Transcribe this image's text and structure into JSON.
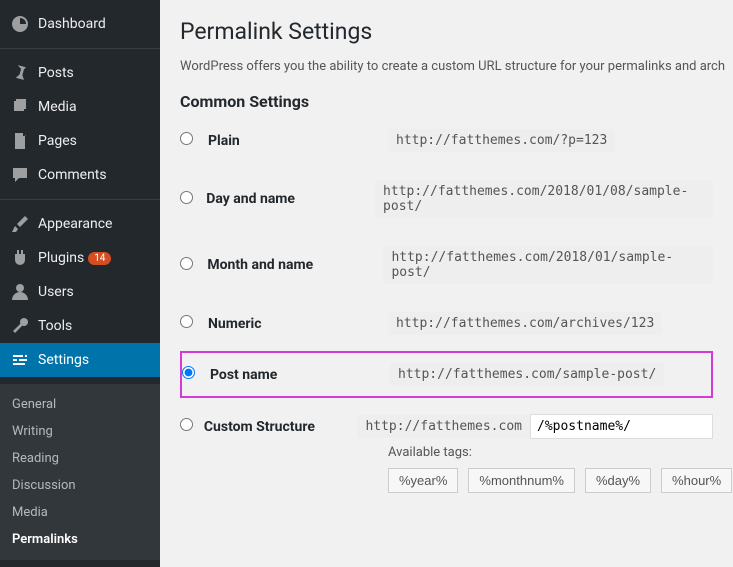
{
  "sidebar": {
    "items": [
      {
        "label": "Dashboard"
      },
      {
        "label": "Posts"
      },
      {
        "label": "Media"
      },
      {
        "label": "Pages"
      },
      {
        "label": "Comments"
      },
      {
        "label": "Appearance"
      },
      {
        "label": "Plugins",
        "badge": "14"
      },
      {
        "label": "Users"
      },
      {
        "label": "Tools"
      },
      {
        "label": "Settings"
      }
    ],
    "submenu": [
      {
        "label": "General"
      },
      {
        "label": "Writing"
      },
      {
        "label": "Reading"
      },
      {
        "label": "Discussion"
      },
      {
        "label": "Media"
      },
      {
        "label": "Permalinks"
      }
    ]
  },
  "page": {
    "title": "Permalink Settings",
    "description": "WordPress offers you the ability to create a custom URL structure for your permalinks and arch",
    "section": "Common Settings"
  },
  "options": {
    "plain": {
      "label": "Plain",
      "url": "http://fatthemes.com/?p=123"
    },
    "dayname": {
      "label": "Day and name",
      "url": "http://fatthemes.com/2018/01/08/sample-post/"
    },
    "monthname": {
      "label": "Month and name",
      "url": "http://fatthemes.com/2018/01/sample-post/"
    },
    "numeric": {
      "label": "Numeric",
      "url": "http://fatthemes.com/archives/123"
    },
    "postname": {
      "label": "Post name",
      "url": "http://fatthemes.com/sample-post/"
    },
    "custom": {
      "label": "Custom Structure",
      "base": "http://fatthemes.com",
      "value": "/%postname%/"
    }
  },
  "tags": {
    "label": "Available tags:",
    "items": [
      "%year%",
      "%monthnum%",
      "%day%",
      "%hour%"
    ]
  }
}
